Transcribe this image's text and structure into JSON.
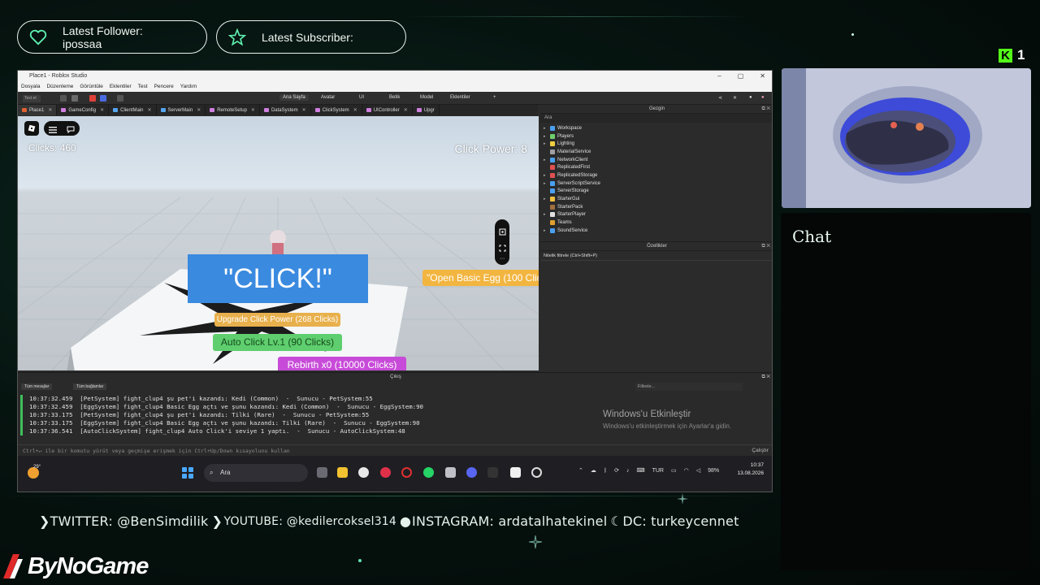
{
  "overlay": {
    "follower_label": "Latest Follower:",
    "follower_name": "ipossaa",
    "subscriber_label": "Latest Subscriber:",
    "subscriber_name": "",
    "kick_count": "1",
    "chat_title": "Chat"
  },
  "studio": {
    "window_title": "Place1 - Roblox Studio",
    "menu": [
      "Dosyala",
      "Düzenleme",
      "Görüntüle",
      "Eklentiler",
      "Test",
      "Pencere",
      "Yardım"
    ],
    "mode_select": "Test et",
    "ribbon_tabs": [
      "Ana Sayfa",
      "Avatar",
      "UI",
      "Betik",
      "Model",
      "Eklentiler",
      "+"
    ],
    "active_ribbon_tab": "Ana Sayfa",
    "doc_tabs": [
      {
        "label": "Place1",
        "color": "#e06030"
      },
      {
        "label": "GameConfig",
        "color": "#d07fdf"
      },
      {
        "label": "ClientMain",
        "color": "#55a5ef"
      },
      {
        "label": "ServerMain",
        "color": "#55a5ef"
      },
      {
        "label": "RemoteSetup",
        "color": "#d07fdf"
      },
      {
        "label": "DataSystem",
        "color": "#d07fdf"
      },
      {
        "label": "ClickSystem",
        "color": "#d07fdf"
      },
      {
        "label": "UIController",
        "color": "#d07fdf"
      },
      {
        "label": "Upgr",
        "color": "#d07fdf"
      }
    ]
  },
  "game": {
    "clicks_label": "Clicks: 460",
    "click_power_label": "Click Power: 8",
    "click_button": "\"CLICK!\"",
    "egg_button": "\"Open Basic Egg (100 Clicks)",
    "upgrade_button": "Upgrade Click Power (268 Clicks)",
    "auto_button": "Auto Click Lv.1 (90 Clicks)",
    "rebirth_button": "Rebirth x0 (10000 Clicks)"
  },
  "explorer": {
    "title": "Gezgin",
    "search_placeholder": "Ara",
    "items": [
      {
        "label": "Workspace",
        "color": "#4a9ff0"
      },
      {
        "label": "Players",
        "color": "#6fcf6f"
      },
      {
        "label": "Lighting",
        "color": "#f0d040"
      },
      {
        "label": "MaterialService",
        "color": "#9fa0a5"
      },
      {
        "label": "NetworkClient",
        "color": "#4a9ff0"
      },
      {
        "label": "ReplicatedFirst",
        "color": "#e05050"
      },
      {
        "label": "ReplicatedStorage",
        "color": "#e05050"
      },
      {
        "label": "ServerScriptService",
        "color": "#4a9ff0"
      },
      {
        "label": "ServerStorage",
        "color": "#4a9ff0"
      },
      {
        "label": "StarterGui",
        "color": "#f0c040"
      },
      {
        "label": "StarterPack",
        "color": "#a07040"
      },
      {
        "label": "StarterPlayer",
        "color": "#e0e0e0"
      },
      {
        "label": "Teams",
        "color": "#e0a030"
      },
      {
        "label": "SoundService",
        "color": "#4a9ff0"
      }
    ]
  },
  "properties": {
    "title": "Özellikler",
    "filter_placeholder": "Nitelik filtrele (Ctrl+Shift+P)"
  },
  "output": {
    "title": "Çıkış",
    "messages_select": "Tüm mesajlar",
    "contexts_select": "Tüm bağlamlar",
    "filter_placeholder": "Filtrele...",
    "lines": [
      "10:37:32.459  [PetSystem] fight_clup4 şu pet'i kazandı: Kedi (Common)  -  Sunucu - PetSystem:55",
      "10:37:32.459  [EggSystem] fight_clup4 Basic Egg açtı ve şunu kazandı: Kedi (Common)  -  Sunucu - EggSystem:90",
      "10:37:33.175  [PetSystem] fight_clup4 şu pet'i kazandı: Tilki (Rare)  -  Sunucu - PetSystem:55",
      "10:37:33.175  [EggSystem] fight_clup4 Basic Egg açtı ve şunu kazandı: Tilki (Rare)  -  Sunucu - EggSystem:90",
      "10:37:36.541  [AutoClickSystem] fight_clup4 Auto Click'i seviye 1 yaptı.  -  Sunucu - AutoClickSystem:48"
    ],
    "command_placeholder": "Ctrl+↵ ile bir komutu yürüt veya geçmişe erişmek için Ctrl+Up/Down kısayolunu kullan",
    "run_label": "Çalıştır",
    "activation_title": "Windows'u Etkinleştir",
    "activation_sub": "Windows'u etkinleştirmek için Ayarlar'a gidin."
  },
  "taskbar": {
    "temperature": "29°",
    "search_placeholder": "Ara",
    "language": "TUR",
    "battery": "98%",
    "time": "10:37",
    "date": "13.08.2026"
  },
  "socials": {
    "twitter": "TWITTER: @BenSimdilik",
    "youtube": "YOUTUBE: @kedilercoksel314",
    "instagram": "INSTAGRAM: ardatalhatekinel",
    "discord": "DC: turkeycennet"
  },
  "brand": "ByNoGame"
}
